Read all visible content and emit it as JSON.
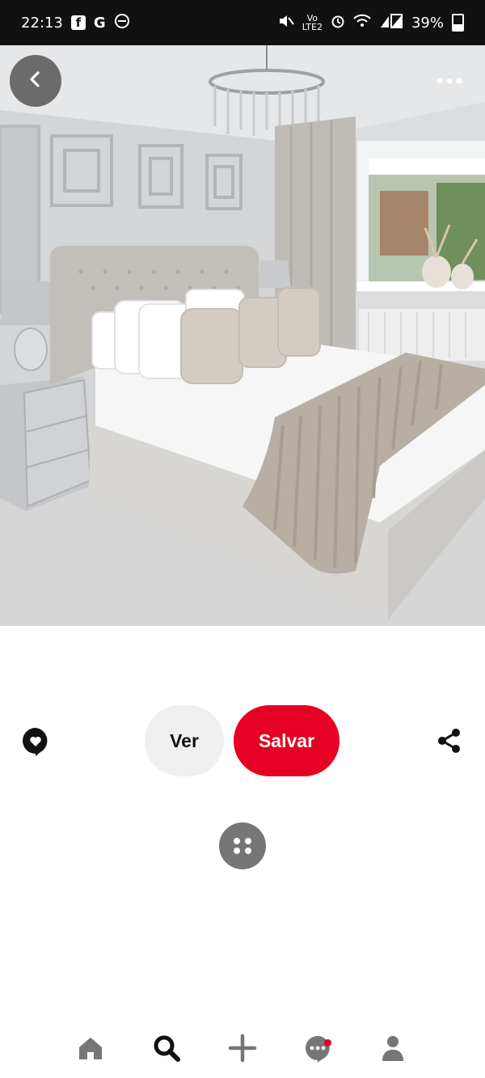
{
  "status_bar": {
    "time": "22:13",
    "battery": "39%",
    "icons": [
      "facebook-icon",
      "google-icon",
      "dnd-icon",
      "mute-icon",
      "volte-icon",
      "alarm-icon",
      "wifi-icon",
      "signal-icon",
      "battery-icon"
    ]
  },
  "pin": {
    "image_subject": "bedroom"
  },
  "top_controls": {
    "back_icon": "chevron-left-icon",
    "more_icon": "ellipsis-icon"
  },
  "actions": {
    "ver_label": "Ver",
    "salvar_label": "Salvar",
    "comment_icon": "comment-heart-icon",
    "share_icon": "share-icon"
  },
  "more_ideas_icon": "dots-cluster-icon",
  "bottom_nav": {
    "items": [
      "home-icon",
      "search-icon",
      "create-icon",
      "messages-icon",
      "profile-icon"
    ],
    "active": "search-icon",
    "notification_on": "messages-icon"
  },
  "colors": {
    "brand_red": "#e60023",
    "nav_gray": "#767676",
    "pill_gray": "#efefef",
    "status_bg": "#111111"
  }
}
